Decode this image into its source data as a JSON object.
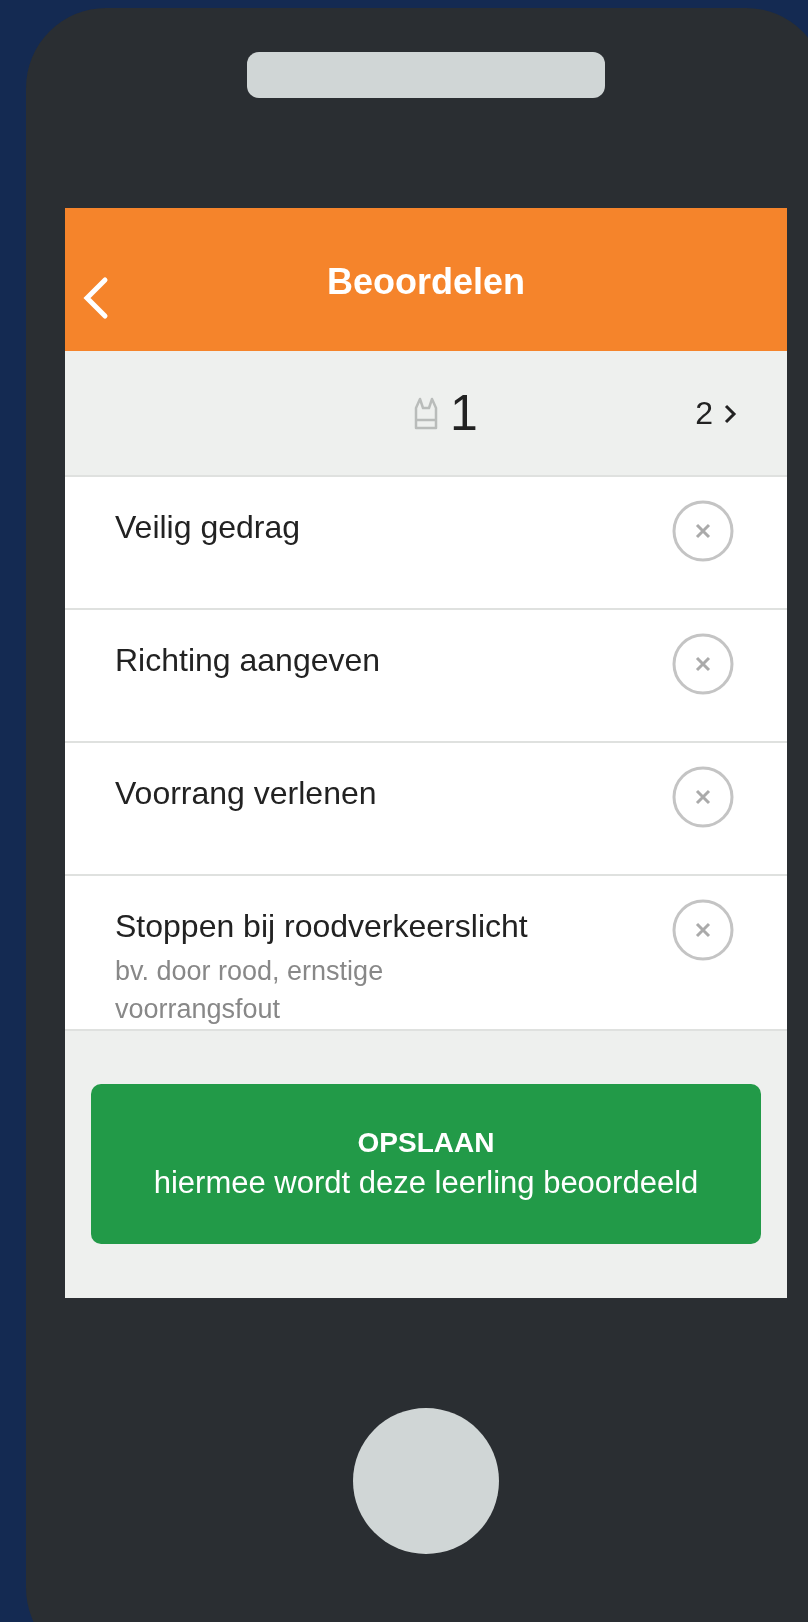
{
  "header": {
    "title": "Beoordelen"
  },
  "student_bar": {
    "current": "1",
    "next": "2"
  },
  "criteria": [
    {
      "label": "Veilig gedrag"
    },
    {
      "label": "Richting aangeven"
    },
    {
      "label": "Voorrang verlenen"
    },
    {
      "label": "Stoppen bij roodverkeerslicht",
      "hint": "bv. door rood, ernstige voorrangsfout"
    }
  ],
  "save_button": {
    "title": "OPSLAAN",
    "subtitle": "hiermee wordt deze leerling beoordeeld"
  }
}
